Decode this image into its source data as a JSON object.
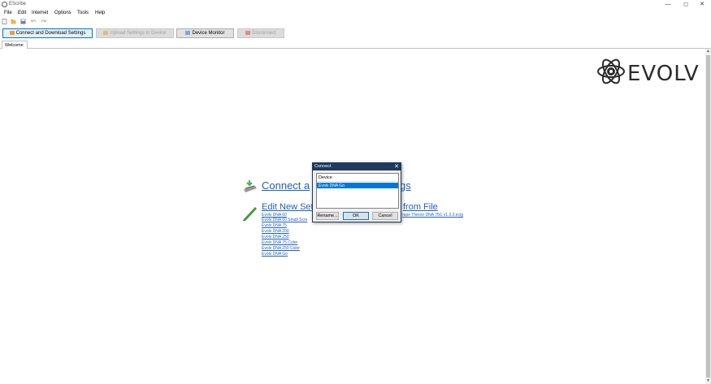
{
  "window": {
    "title": "EScribe",
    "controls": [
      "—",
      "◻",
      "✕"
    ]
  },
  "menu": [
    "File",
    "Edit",
    "Internet",
    "Options",
    "Tools",
    "Help"
  ],
  "toolbar_icons": [
    "new-icon",
    "open-icon",
    "save-icon",
    "undo-icon",
    "redo-icon"
  ],
  "buttons": {
    "connect": "Connect and Download Settings",
    "upload": "Upload Settings to Device",
    "monitor": "Device Monitor",
    "disconnect": "Disconnect"
  },
  "tabs": [
    "Welcome"
  ],
  "logo": {
    "text": "EVOLV"
  },
  "welcome": {
    "connect_link_left": "Connect a",
    "connect_link_right": "gs",
    "edit_new_left": "Edit New Settin",
    "edit_from_file_right": "from File",
    "devices": [
      "Evolv DNA 60",
      "Evolv DNA 60 Small Scre",
      "Evolv DNA 75",
      "Evolv DNA 200",
      "Evolv DNA 250",
      "Evolv DNA 75 Color",
      "Evolv DNA 250 Color",
      "Evolv DNA Go"
    ],
    "recent_file": "rape Theron DNA 75C v1.2.3.ecig"
  },
  "dialog": {
    "title": "Connect",
    "close": "✕",
    "column_header": "Device",
    "selected_device": "Evolv DNA Go",
    "rename": "Rename...",
    "ok": "OK",
    "cancel": "Cancel"
  },
  "colors": {
    "link": "#1f5fbf",
    "selection": "#0078d7",
    "dialog_title": "#1e3a5f"
  }
}
